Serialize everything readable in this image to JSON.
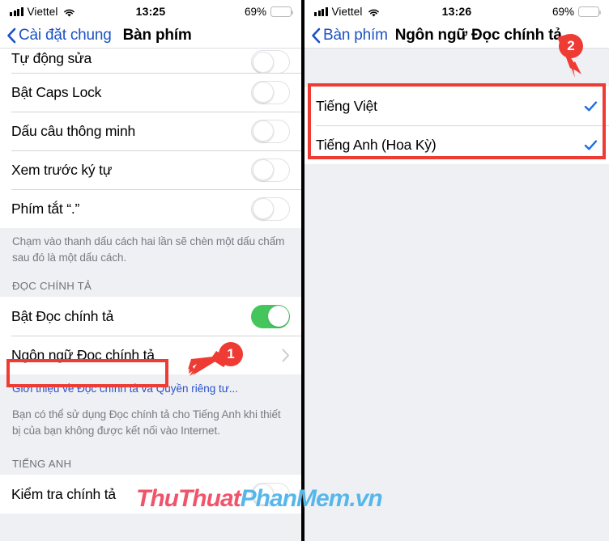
{
  "watermark": {
    "part1": "ThuThuat",
    "part2": "PhanMem",
    "part3": ".vn"
  },
  "left_phone": {
    "status": {
      "carrier": "Viettel",
      "time": "13:25",
      "battery": "69%"
    },
    "nav": {
      "back_label": "Cài đặt chung",
      "title": "Bàn phím"
    },
    "rows": [
      {
        "label": "Tự động sửa",
        "toggle": "off"
      },
      {
        "label": "Bật Caps Lock",
        "toggle": "off"
      },
      {
        "label": "Dấu câu thông minh",
        "toggle": "off"
      },
      {
        "label": "Xem trước ký tự",
        "toggle": "off"
      },
      {
        "label": "Phím tắt “.”",
        "toggle": "off"
      }
    ],
    "footnote": "Chạm vào thanh dấu cách hai lần sẽ chèn một dấu chấm sau đó là một dấu cách.",
    "section_dictation": "ĐỌC CHÍNH TẢ",
    "dictation_rows": [
      {
        "label": "Bật Đọc chính tả",
        "toggle": "on"
      },
      {
        "label": "Ngôn ngữ Đọc chính tả",
        "accessory": "chevron"
      }
    ],
    "privacy_link": "Giới thiệu về Đọc chính tả và Quyền riêng tư...",
    "dictation_note": "Bạn có thể sử dụng Đọc chính tả cho Tiếng Anh khi thiết bị của bạn không được kết nối vào Internet.",
    "section_english": "TIẾNG ANH",
    "english_rows": [
      {
        "label": "Kiểm tra chính tả",
        "toggle": "off"
      }
    ]
  },
  "right_phone": {
    "status": {
      "carrier": "Viettel",
      "time": "13:26",
      "battery": "69%"
    },
    "nav": {
      "back_label": "Bàn phím",
      "title": "Ngôn ngữ Đọc chính tả"
    },
    "languages": [
      {
        "label": "Tiếng Việt",
        "selected": true
      },
      {
        "label": "Tiếng Anh (Hoa Kỳ)",
        "selected": true
      }
    ]
  },
  "annotations": [
    {
      "number": "1",
      "target": "Ngôn ngữ Đọc chính tả"
    },
    {
      "number": "2",
      "target": "Danh sách ngôn ngữ"
    }
  ],
  "colors": {
    "accent_blue": "#1b52c4",
    "toggle_on_green": "#44c65c",
    "annotation_red": "#ee3b33",
    "battery_yellow": "#f9cf26",
    "background_gray": "#eff0f4"
  }
}
